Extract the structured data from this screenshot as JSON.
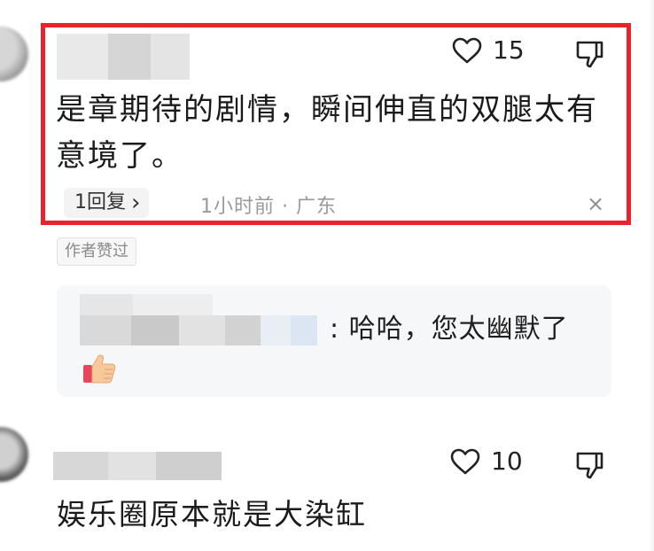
{
  "comment_main": {
    "like_count": "15",
    "text": "是章期待的剧情，瞬间伸直的双腿太有意境了。",
    "reply_label": "1回复",
    "reply_chevron": "›",
    "meta": "1小时前 · 广东",
    "close_glyph": "×",
    "author_badge": "作者赞过",
    "highlight_color": "#e8232b"
  },
  "reply": {
    "text": ": 哈哈，您太幽默了",
    "emoji_icon": "thumbs-up-icon"
  },
  "comment_second": {
    "like_count": "10",
    "text": "娱乐圈原本就是大染缸"
  },
  "icons": {
    "like": "heart-outline-icon",
    "dislike": "thumbs-down-icon",
    "close": "close-icon"
  }
}
